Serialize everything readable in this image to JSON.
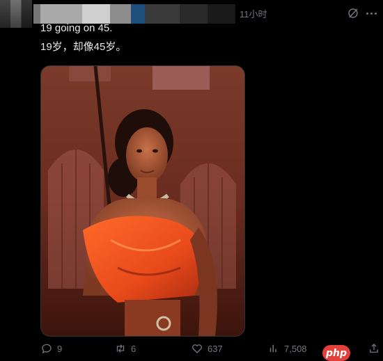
{
  "post": {
    "timestamp": "11小时",
    "text_line1": "19 going on 45.",
    "text_line2": "19岁，却像45岁。"
  },
  "actions": {
    "replies": "9",
    "reposts": "6",
    "likes": "637",
    "views": "7,508"
  },
  "icons": {
    "reply": "reply-icon",
    "repost": "repost-icon",
    "like": "heart-icon",
    "views": "analytics-icon",
    "bookmark": "bookmark-icon",
    "share": "share-icon",
    "grok": "grok-icon",
    "more": "more-icon"
  },
  "watermark": {
    "text": "php"
  },
  "colors": {
    "background": "#000000",
    "text": "#e7e9ea",
    "muted": "#71767b",
    "watermark": "#e3403a"
  }
}
